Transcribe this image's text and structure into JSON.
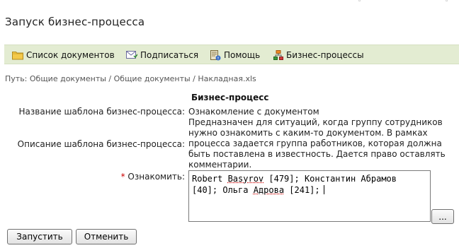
{
  "window": {
    "title": "Запуск бизнес-процесса"
  },
  "toolbar": {
    "items": [
      {
        "label": "Список документов",
        "icon": "folder-icon"
      },
      {
        "label": "Подписаться",
        "icon": "envelope-icon"
      },
      {
        "label": "Помощь",
        "icon": "help-book-icon"
      },
      {
        "label": "Бизнес-процессы",
        "icon": "business-process-icon"
      }
    ]
  },
  "breadcrumb": "Путь: Общие документы / Общие документы / Накладная.xls",
  "form": {
    "section_title": "Бизнес-процесс",
    "template_name_label": "Название шаблона бизнес-процесса:",
    "template_name_value": "Ознакомление с документом",
    "template_desc_label": "Описание шаблона бизнес-процесса:",
    "template_desc_value": "Предназначен для ситуаций, когда группу сотрудников нужно ознакомить с каким-то документом. В рамках процесса задается группа работников, которая должна быть поставлена в известность. Дается право оставлять комментарии.",
    "familiarize_required_mark": "*",
    "familiarize_label": "Ознакомить:",
    "familiarize_value": {
      "seg1": "Robert ",
      "seg2": "Basyrov",
      "seg3": " [479]; Константин Абрамов [40]; Ольга ",
      "seg4": "Адрова",
      "seg5": " [241];"
    },
    "browse_label": "..."
  },
  "buttons": {
    "start": "Запустить",
    "cancel": "Отменить"
  },
  "colors": {
    "toolbar_bg": "#e3ecd2",
    "folder": "#f3c94a",
    "required": "#cc0000"
  }
}
